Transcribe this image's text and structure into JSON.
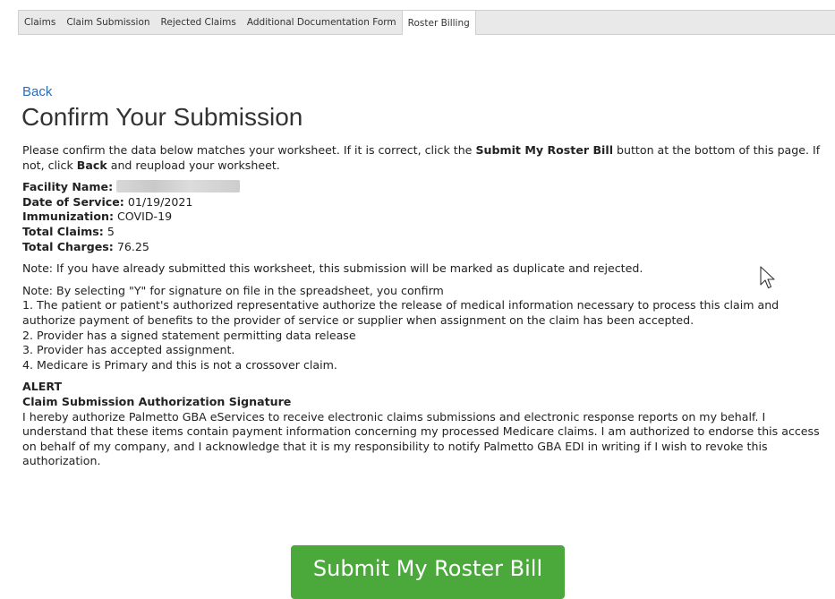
{
  "tabs": [
    {
      "label": "Claims"
    },
    {
      "label": "Claim Submission"
    },
    {
      "label": "Rejected Claims"
    },
    {
      "label": "Additional Documentation Form"
    },
    {
      "label": "Roster Billing",
      "active": true
    }
  ],
  "back_label": "Back",
  "page_title": "Confirm Your Submission",
  "intro": {
    "part1": "Please confirm the data below matches your worksheet. If it is correct, click the ",
    "bold1": "Submit My Roster Bill",
    "part2": " button at the bottom of this page. If not, click ",
    "bold2": "Back",
    "part3": " and reupload your worksheet."
  },
  "details": {
    "facility_label": "Facility Name:",
    "dos_label": "Date of Service:",
    "dos_value": "01/19/2021",
    "immunization_label": "Immunization:",
    "immunization_value": "COVID-19",
    "total_claims_label": "Total Claims:",
    "total_claims_value": "5",
    "total_charges_label": "Total Charges:",
    "total_charges_value": "76.25"
  },
  "note_duplicate": "Note: If you have already submitted this worksheet, this submission will be marked as duplicate and rejected.",
  "note_signature": {
    "lead": "Note: By selecting \"Y\" for signature on file in the spreadsheet, you confirm",
    "items": [
      "1. The patient or patient's authorized representative authorize the release of medical information necessary to process this claim and authorize payment of benefits to the provider of service or supplier when assignment on the claim has been accepted.",
      "2. Provider has a signed statement permitting data release",
      "3. Provider has accepted assignment.",
      "4. Medicare is Primary and this is not a crossover claim."
    ]
  },
  "alert": {
    "label": "ALERT",
    "heading": "Claim Submission Authorization Signature",
    "body": "I hereby authorize Palmetto GBA eServices to receive electronic claims submissions and electronic response reports on my behalf. I understand that these items contain payment information concerning my processed Medicare claims. I am authorized to endorse this access on behalf of my company, and I acknowledge that it is my responsibility to notify Palmetto GBA EDI in writing if I wish to revoke this authorization."
  },
  "submit_label": "Submit My Roster Bill",
  "colors": {
    "link": "#2a6db5",
    "submit_bg": "#4aa93a",
    "tab_bg": "#e9e9e9"
  },
  "icons": {
    "cursor": "mouse-pointer-icon"
  }
}
